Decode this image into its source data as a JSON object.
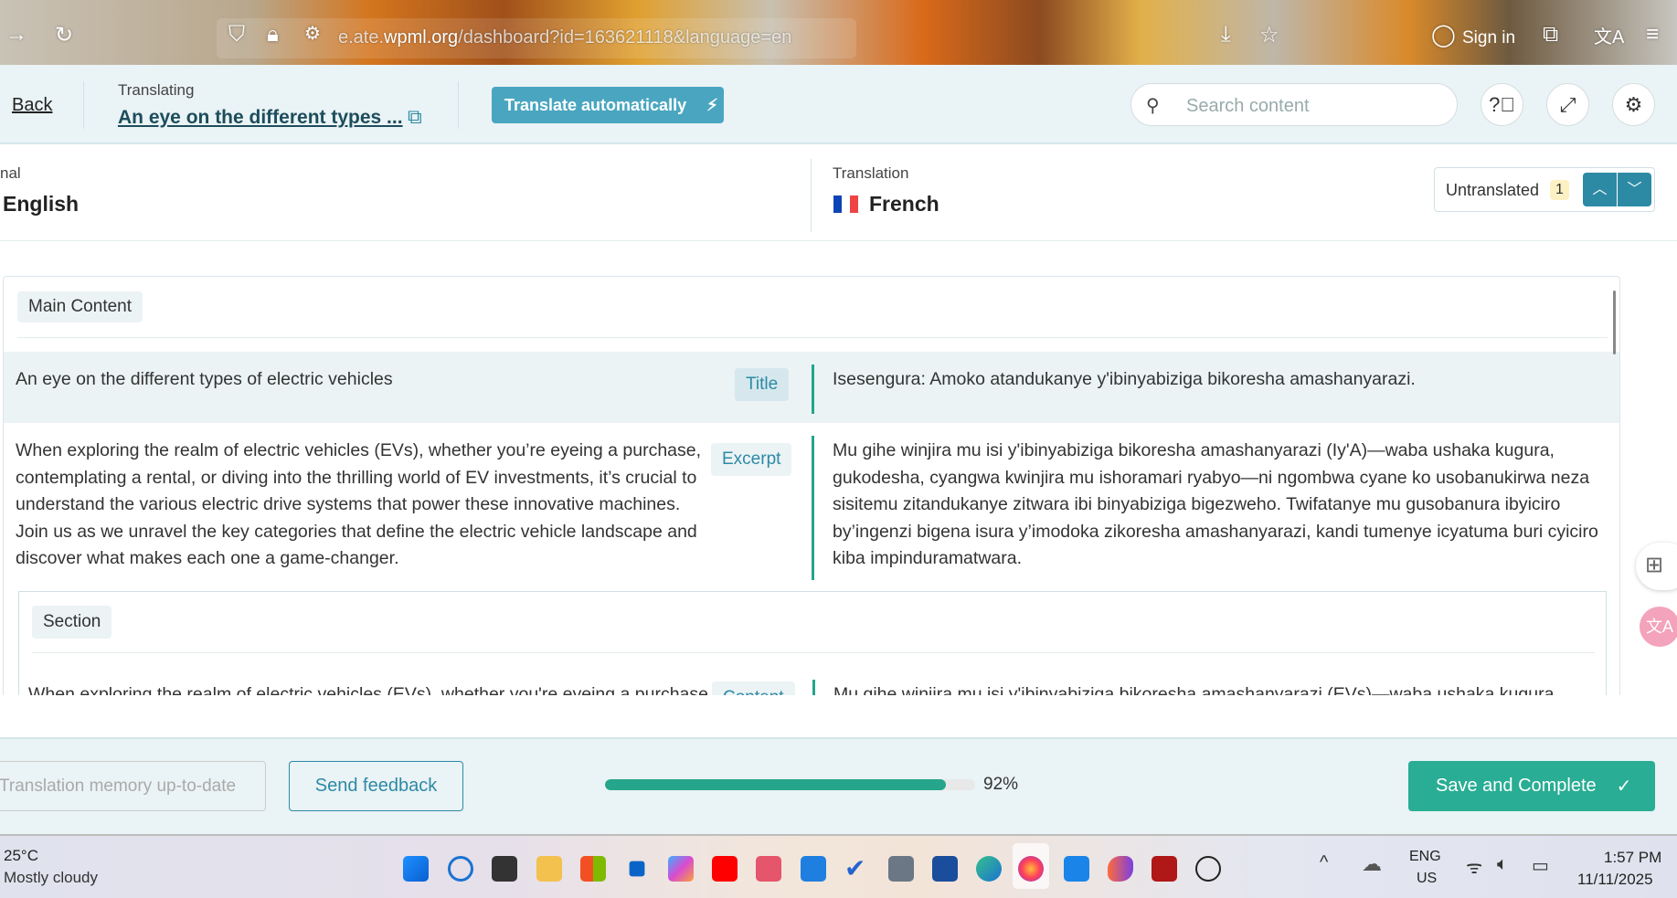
{
  "browser": {
    "url_prefix": "e.ate.",
    "url_domain": "wpml.org",
    "url_rest": "/dashboard?id=163621118&language=en",
    "sign_in": "Sign in"
  },
  "header": {
    "back": "Back",
    "translating_label": "Translating",
    "doc_title": "An eye on the different types ...",
    "translate_auto": "Translate automatically",
    "search_placeholder": "Search content"
  },
  "languages": {
    "original_label": "nal",
    "original": "English",
    "translation_label": "Translation",
    "translation": "French",
    "filter": "Untranslated",
    "filter_count": "1"
  },
  "content": {
    "group": "Main Content",
    "rows": [
      {
        "source": "An eye on the different types of electric vehicles",
        "type": "Title",
        "target": "Isesengura: Amoko atandukanye y'ibinyabiziga bikoresha amashanyarazi."
      },
      {
        "source": "When exploring the realm of electric vehicles (EVs), whether you’re eyeing a purchase, contemplating a rental, or diving into the thrilling world of EV investments, it’s crucial to understand the various electric drive systems that power these innovative machines. Join us as we unravel the key categories that define the electric vehicle landscape and discover what makes each one a game-changer.",
        "type": "Excerpt",
        "target": "Mu gihe winjira mu isi y'ibinyabiziga bikoresha amashanyarazi (Iy'A)—waba ushaka kugura, gukodesha, cyangwa kwinjira mu ishoramari ryabyo—ni ngombwa cyane ko usobanukirwa neza sisitemu zitandukanye zitwara ibi binyabiziga bigezweho. Twifatanye mu gusobanura ibyiciro by’ingenzi bigena isura y’imodoka zikoresha amashanyarazi, kandi tumenye icyatuma buri cyiciro kiba impinduramatwara."
      }
    ],
    "section": "Section",
    "section_row": {
      "source": "When exploring the realm of electric vehicles (EVs), whether you're eyeing a purchase,",
      "type": "Content",
      "target": "Mu gihe winjira mu isi y'ibinyabiziga bikoresha amashanyarazi (EVs)—waba ushaka kugura,"
    }
  },
  "footer": {
    "tm": "Translation memory up-to-date",
    "feedback": "Send feedback",
    "progress": 92,
    "progress_label": "92%",
    "save": "Save and Complete"
  },
  "taskbar": {
    "temp": "25°C",
    "weather": "Mostly cloudy",
    "lang1": "ENG",
    "lang2": "US",
    "time": "1:57 PM",
    "date": "11/11/2025"
  },
  "colors": {
    "accent": "#25a58b",
    "blue": "#4aa6c0",
    "nav": "#2d8aa5"
  }
}
